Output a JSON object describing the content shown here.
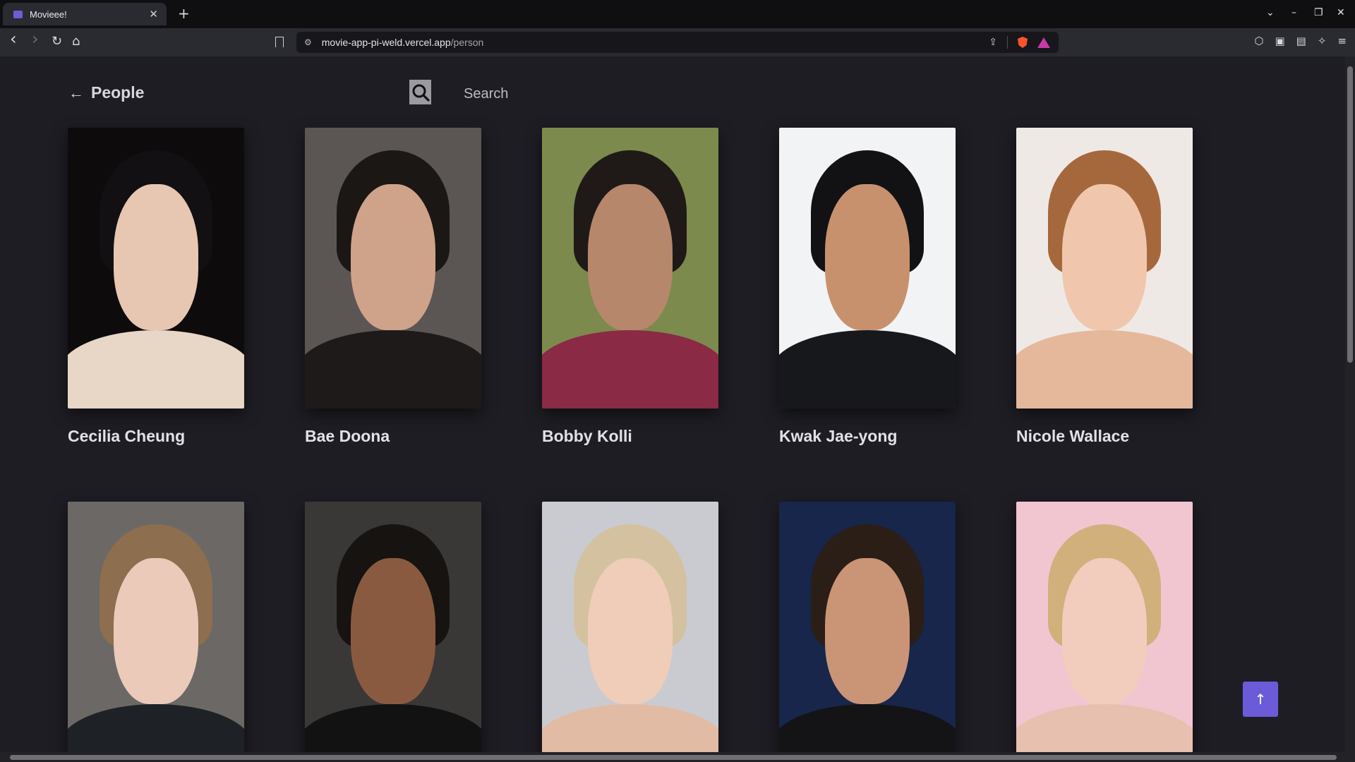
{
  "browser": {
    "tab_title": "Movieee!",
    "tab_close": "✕",
    "new_tab": "+",
    "url_host": "movie-app-pi-weld.vercel.app",
    "url_path": "/person",
    "nav": {
      "back": "‹",
      "forward": "›",
      "reload": "↻",
      "home": "⌂"
    },
    "win": {
      "tablist": "⌄",
      "minimize": "–",
      "restore": "❐",
      "close": "✕"
    }
  },
  "header": {
    "back_arrow": "←",
    "title": "People",
    "search_placeholder": "Search"
  },
  "people": [
    {
      "name": "Cecilia Cheung",
      "bg": "#0d0b0c",
      "hair": "#121012",
      "skin": "#e7c6b2",
      "body": "#e8d6c6"
    },
    {
      "name": "Bae Doona",
      "bg": "#5b5654",
      "hair": "#1b1715",
      "skin": "#cfa38a",
      "body": "#1d1a19"
    },
    {
      "name": "Bobby Kolli",
      "bg": "#7c8a4d",
      "hair": "#1f1a18",
      "skin": "#b7876b",
      "body": "#8a2a45"
    },
    {
      "name": "Kwak Jae-yong",
      "bg": "#f2f3f5",
      "hair": "#121214",
      "skin": "#c8916d",
      "body": "#16181c"
    },
    {
      "name": "Nicole Wallace",
      "bg": "#efe9e6",
      "hair": "#a5683c",
      "skin": "#f0c7ad",
      "body": "#e5b89b"
    },
    {
      "name": "",
      "bg": "#6c6865",
      "hair": "#8d6e4f",
      "skin": "#ebcab9",
      "body": "#1e2226"
    },
    {
      "name": "",
      "bg": "#3a3837",
      "hair": "#161311",
      "skin": "#8a5a40",
      "body": "#121213"
    },
    {
      "name": "",
      "bg": "#c9cbd0",
      "hair": "#d4c1a0",
      "skin": "#efcdb9",
      "body": "#e2bba5"
    },
    {
      "name": "",
      "bg": "#17264a",
      "hair": "#2b1e16",
      "skin": "#c99576",
      "body": "#141416"
    },
    {
      "name": "",
      "bg": "#f1c6d1",
      "hair": "#d1b07c",
      "skin": "#f2cdbd",
      "body": "#e8c0b0"
    }
  ],
  "scroll_top_icon": "↑"
}
